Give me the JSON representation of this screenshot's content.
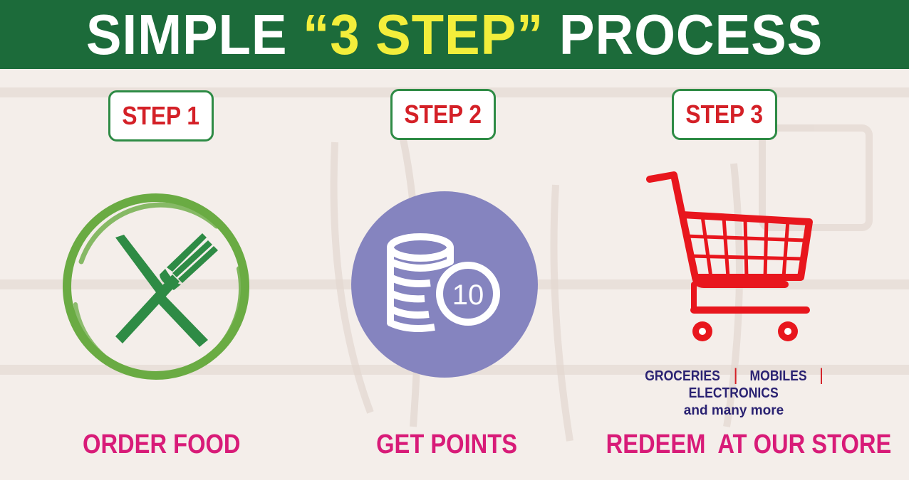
{
  "header": {
    "title_before": "SIMPLE ",
    "title_highlight": "“3 STEP”",
    "title_after": " PROCESS",
    "bg_color": "#1c6b3a",
    "highlight_color": "#f3ee3b"
  },
  "steps": [
    {
      "badge": "STEP 1",
      "caption": "ORDER FOOD",
      "icon": "fork-knife-icon"
    },
    {
      "badge": "STEP 2",
      "caption": "GET POINTS",
      "icon": "coins-icon",
      "coin_value": "10"
    },
    {
      "badge": "STEP 3",
      "caption": "REDEEM  AT OUR STORE",
      "icon": "shopping-cart-icon"
    }
  ],
  "store_categories": {
    "items": [
      "GROCERIES",
      "MOBILES",
      "ELECTRONICS"
    ],
    "separator": "|",
    "more": "and many more"
  },
  "colors": {
    "badge_text": "#d42027",
    "badge_border": "#2e8b45",
    "caption": "#d81b78",
    "plate_ring": "#6aab43",
    "cutlery": "#2e8b45",
    "coin_circle": "#8584bf",
    "cart": "#e8161d",
    "categories_text": "#2a2272"
  }
}
